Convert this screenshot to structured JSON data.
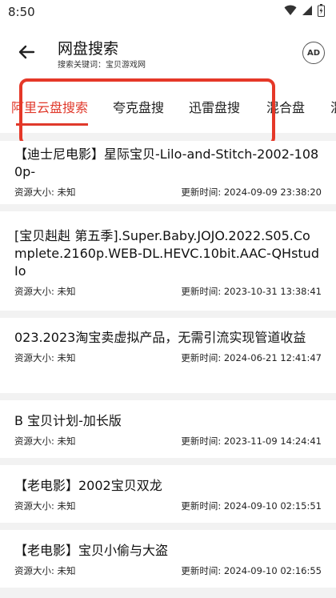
{
  "status": {
    "time": "8:50"
  },
  "header": {
    "title": "网盘搜索",
    "subtitle": "搜索关键词：宝贝游戏网",
    "ad_label": "AD"
  },
  "tabs": [
    {
      "label": "阿里云盘搜索"
    },
    {
      "label": "夸克盘搜"
    },
    {
      "label": "迅雷盘搜"
    },
    {
      "label": "混合盘"
    },
    {
      "label": "混"
    }
  ],
  "items": [
    {
      "title": "【迪士尼电影】星际宝贝-Lilo-and-Stitch-2002-1080p-",
      "size": "资源大小: 未知",
      "updated": "更新时间: 2024-09-09 23:38:20"
    },
    {
      "title": "[宝贝赳赳 第五季].Super.Baby.JOJO.2022.S05.Complete.2160p.WEB-DL.HEVC.10bit.AAC-QHstudIo",
      "size": "资源大小: 未知",
      "updated": "更新时间: 2023-10-31 13:38:41"
    },
    {
      "title": "023.2023淘宝卖虚拟产品，无需引流实现管道收益",
      "size": "资源大小: 未知",
      "updated": "更新时间: 2024-06-21 12:41:47"
    },
    {
      "title": "B 宝贝计划-加长版",
      "size": "资源大小: 未知",
      "updated": "更新时间: 2023-11-09 14:24:41"
    },
    {
      "title": "【老电影】2002宝贝双龙",
      "size": "资源大小: 未知",
      "updated": "更新时间: 2024-09-10 02:15:51"
    },
    {
      "title": "【老电影】宝贝小偷与大盗",
      "size": "资源大小: 未知",
      "updated": "更新时间: 2024-09-10 02:16:55"
    }
  ]
}
